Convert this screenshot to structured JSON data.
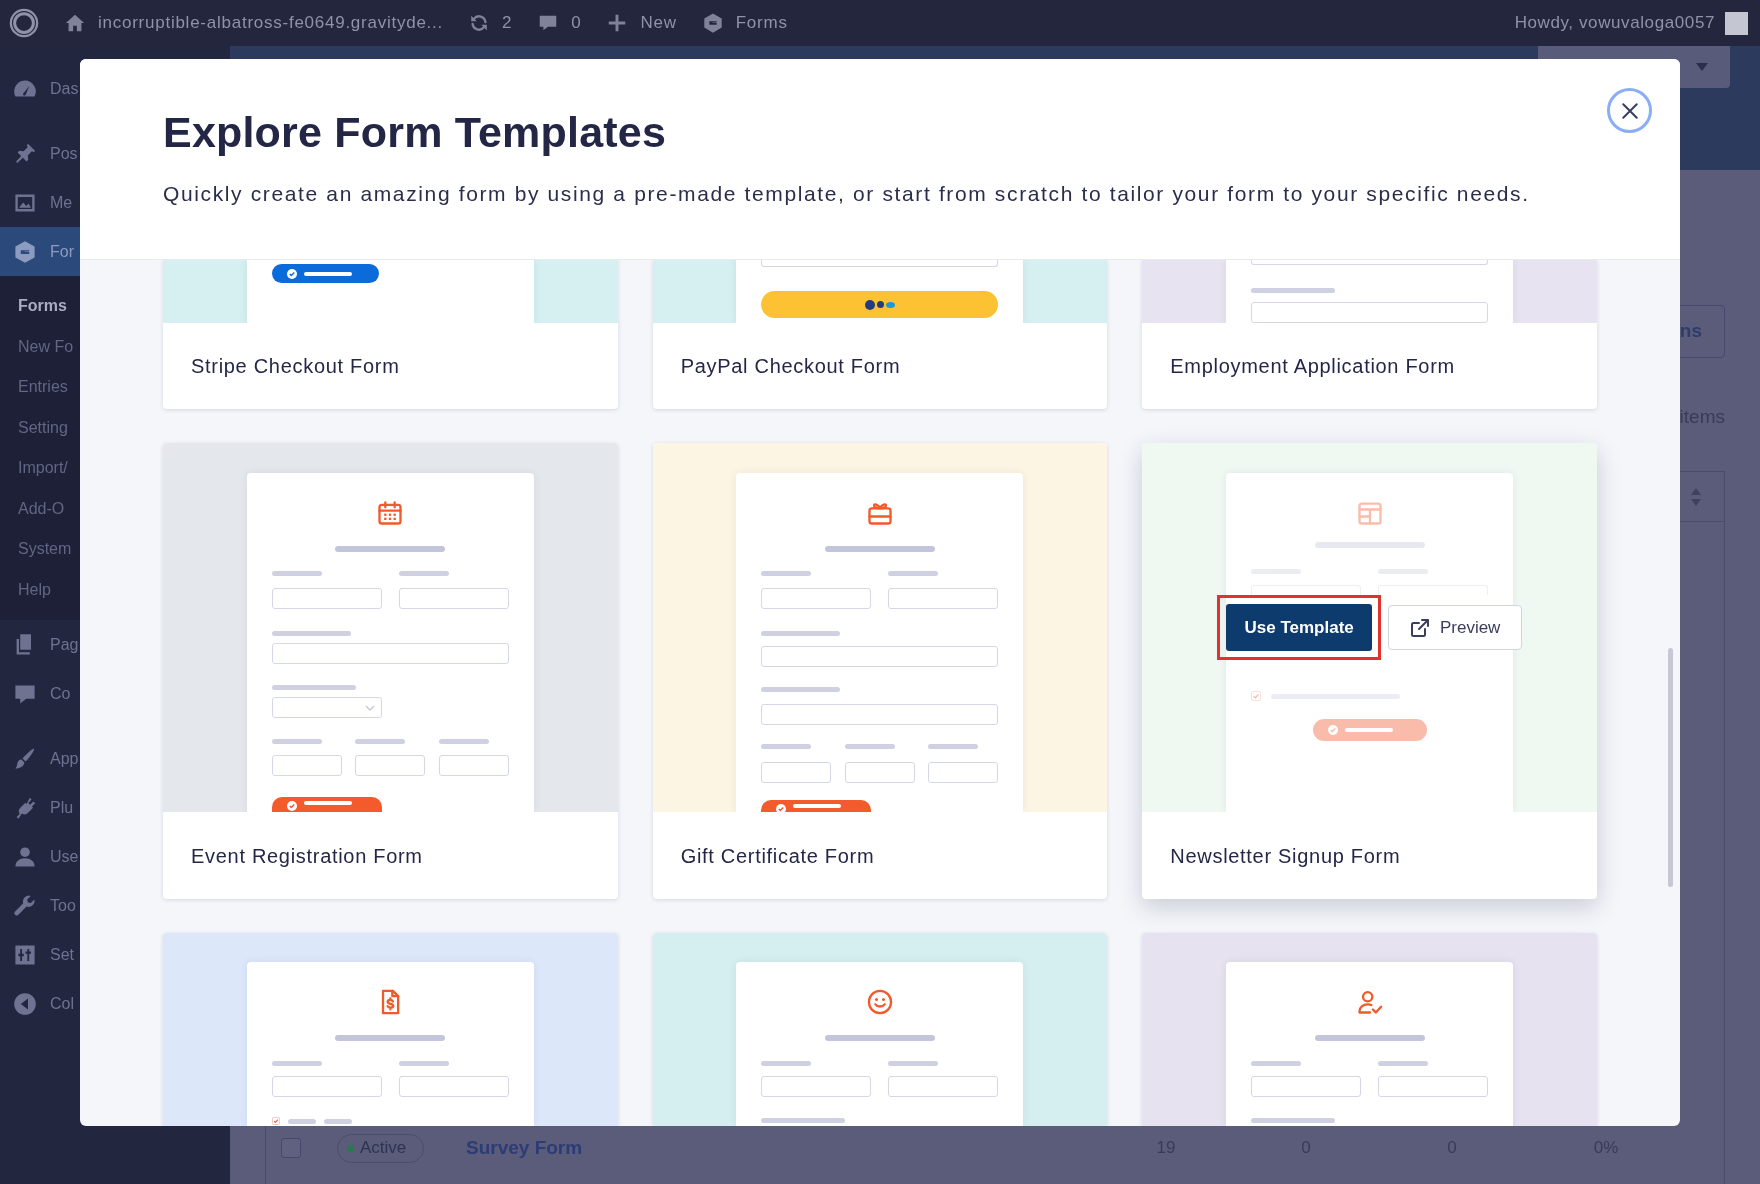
{
  "admin_bar": {
    "items": [
      {
        "label": "incorruptible-albatross-fe0649.gravityde..."
      },
      {
        "label": "2"
      },
      {
        "label": "0"
      },
      {
        "label": "New"
      },
      {
        "label": "Forms"
      }
    ],
    "greeting": "Howdy, vowuvaloga0057"
  },
  "sidebar": {
    "groups": [
      {
        "items": [
          {
            "label": "Das",
            "selected": false
          }
        ]
      },
      {
        "items": [
          {
            "label": "Pos",
            "selected": false
          },
          {
            "label": "Me",
            "selected": false
          },
          {
            "label": "For",
            "selected": true,
            "children": [
              {
                "label": "Forms",
                "selected": true
              },
              {
                "label": "New Fo",
                "selected": false
              },
              {
                "label": "Entries",
                "selected": false
              },
              {
                "label": "Setting",
                "selected": false
              },
              {
                "label": "Import/",
                "selected": false
              },
              {
                "label": "Add-O",
                "selected": false
              },
              {
                "label": "System",
                "selected": false
              },
              {
                "label": "Help",
                "selected": false
              }
            ]
          },
          {
            "label": "Pag",
            "selected": false
          },
          {
            "label": "Co",
            "selected": false
          }
        ]
      },
      {
        "items": [
          {
            "label": "App",
            "selected": false
          },
          {
            "label": "Plu",
            "selected": false
          },
          {
            "label": "Use",
            "selected": false
          },
          {
            "label": "Too",
            "selected": false
          },
          {
            "label": "Set",
            "selected": false
          },
          {
            "label": "Col",
            "selected": false
          }
        ]
      }
    ]
  },
  "page": {
    "button": {
      "label": "ns"
    },
    "count_text": "items",
    "table": {
      "rows": [
        {
          "checked": false,
          "cells": [
            "Active",
            "Survey Form",
            "19",
            "0",
            "0",
            "0%"
          ]
        }
      ]
    }
  },
  "modal": {
    "title": "Explore Form Templates",
    "subtitle": "Quickly create an amazing form by using a pre-made template, or start from scratch to tailor your form to your specific needs.",
    "close_button": {
      "focused": true
    },
    "templates": [
      {
        "kind": "stripe",
        "color": "#d6eff0",
        "title": "Stripe Checkout Form",
        "hovered": false
      },
      {
        "kind": "paypal",
        "color": "#d6eff0",
        "title": "PayPal Checkout Form",
        "hovered": false
      },
      {
        "kind": "employment",
        "color": "#e7e3f1",
        "title": "Employment Application Form",
        "hovered": false
      },
      {
        "kind": "event",
        "color": "#e4e7eb",
        "title": "Event Registration Form",
        "hovered": false
      },
      {
        "kind": "gift",
        "color": "#fdf5e3",
        "title": "Gift Certificate Form",
        "hovered": false
      },
      {
        "kind": "newsletter",
        "color": "#eff8f1",
        "title": "Newsletter Signup Form",
        "hovered": true,
        "actions": [
          {
            "kind": "primary",
            "label": "Use Template",
            "highlighted": true
          },
          {
            "kind": "secondary",
            "label": "Preview",
            "highlighted": false
          }
        ]
      },
      {
        "kind": "invoice",
        "color": "#dce7fa",
        "hovered": false
      },
      {
        "kind": "smiley",
        "color": "#d5eff0",
        "hovered": false
      },
      {
        "kind": "user",
        "color": "#e6e2f0",
        "hovered": false
      }
    ]
  }
}
